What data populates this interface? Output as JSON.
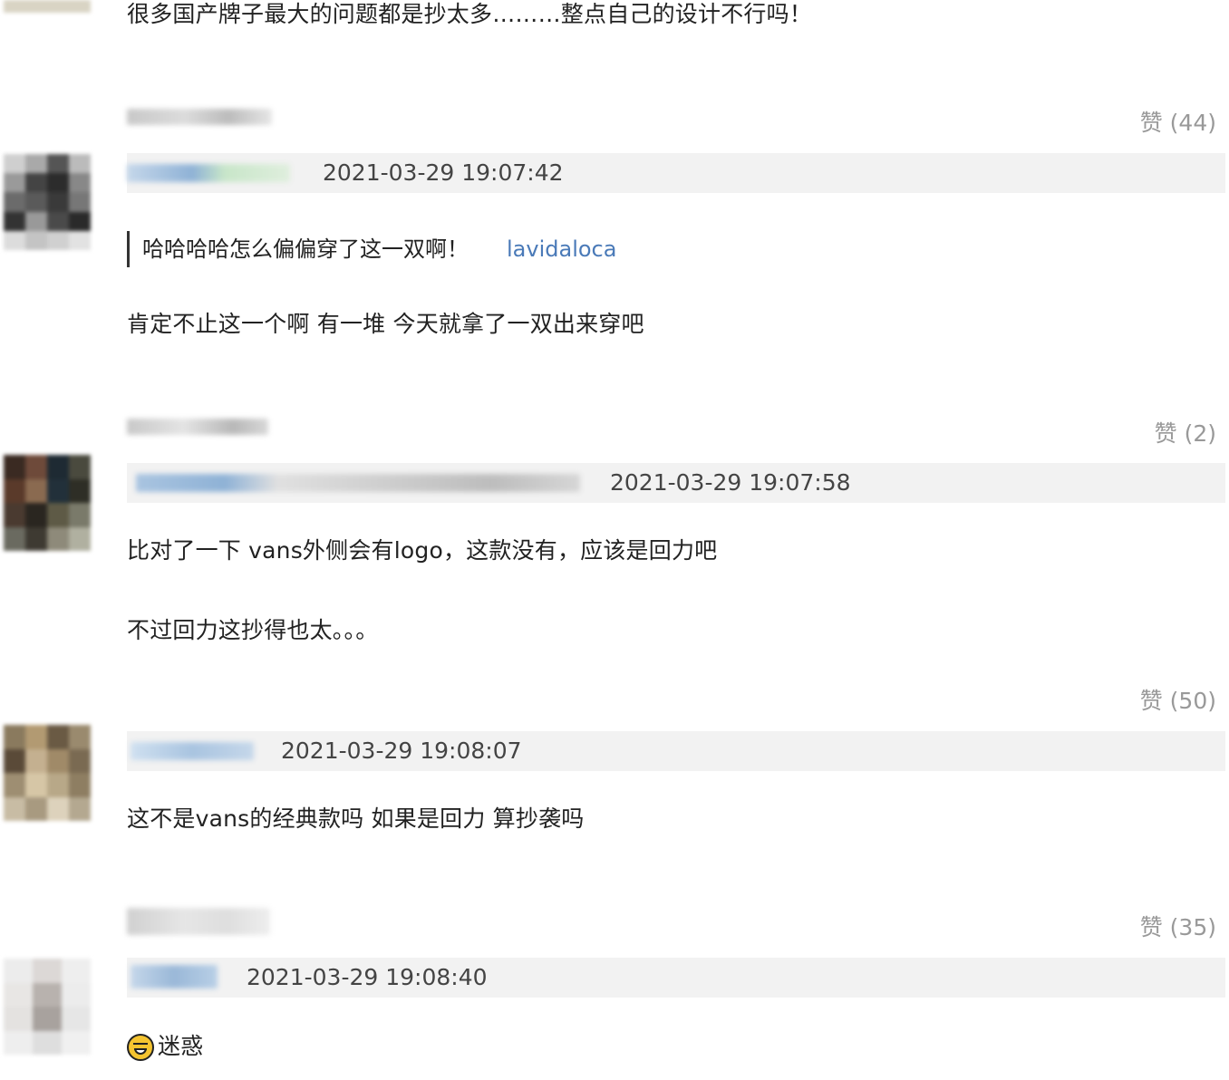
{
  "top_comment": {
    "text": "很多国产牌子最大的问题都是抄太多………整点自己的设计不行吗！"
  },
  "comments": [
    {
      "like_label": "赞 (44)",
      "timestamp": "2021-03-29 19:07:42",
      "quote_text": "哈哈哈哈怎么偏偏穿了这一双啊！",
      "quote_author": "lavidaloca",
      "body": [
        "肯定不止这一个啊 有一堆 今天就拿了一双出来穿吧"
      ]
    },
    {
      "like_label": "赞 (2)",
      "timestamp": "2021-03-29 19:07:58",
      "body": [
        "比对了一下 vans外侧会有logo，这款没有，应该是回力吧",
        "不过回力这抄得也太。。。"
      ]
    },
    {
      "like_label": "赞 (50)",
      "timestamp": "2021-03-29 19:08:07",
      "body": [
        "这不是vans的经典款吗 如果是回力 算抄袭吗"
      ]
    },
    {
      "like_label": "赞 (35)",
      "timestamp": "2021-03-29 19:08:40",
      "body": [
        "迷惑"
      ],
      "emoji": "grinning-tears-emoji"
    }
  ]
}
